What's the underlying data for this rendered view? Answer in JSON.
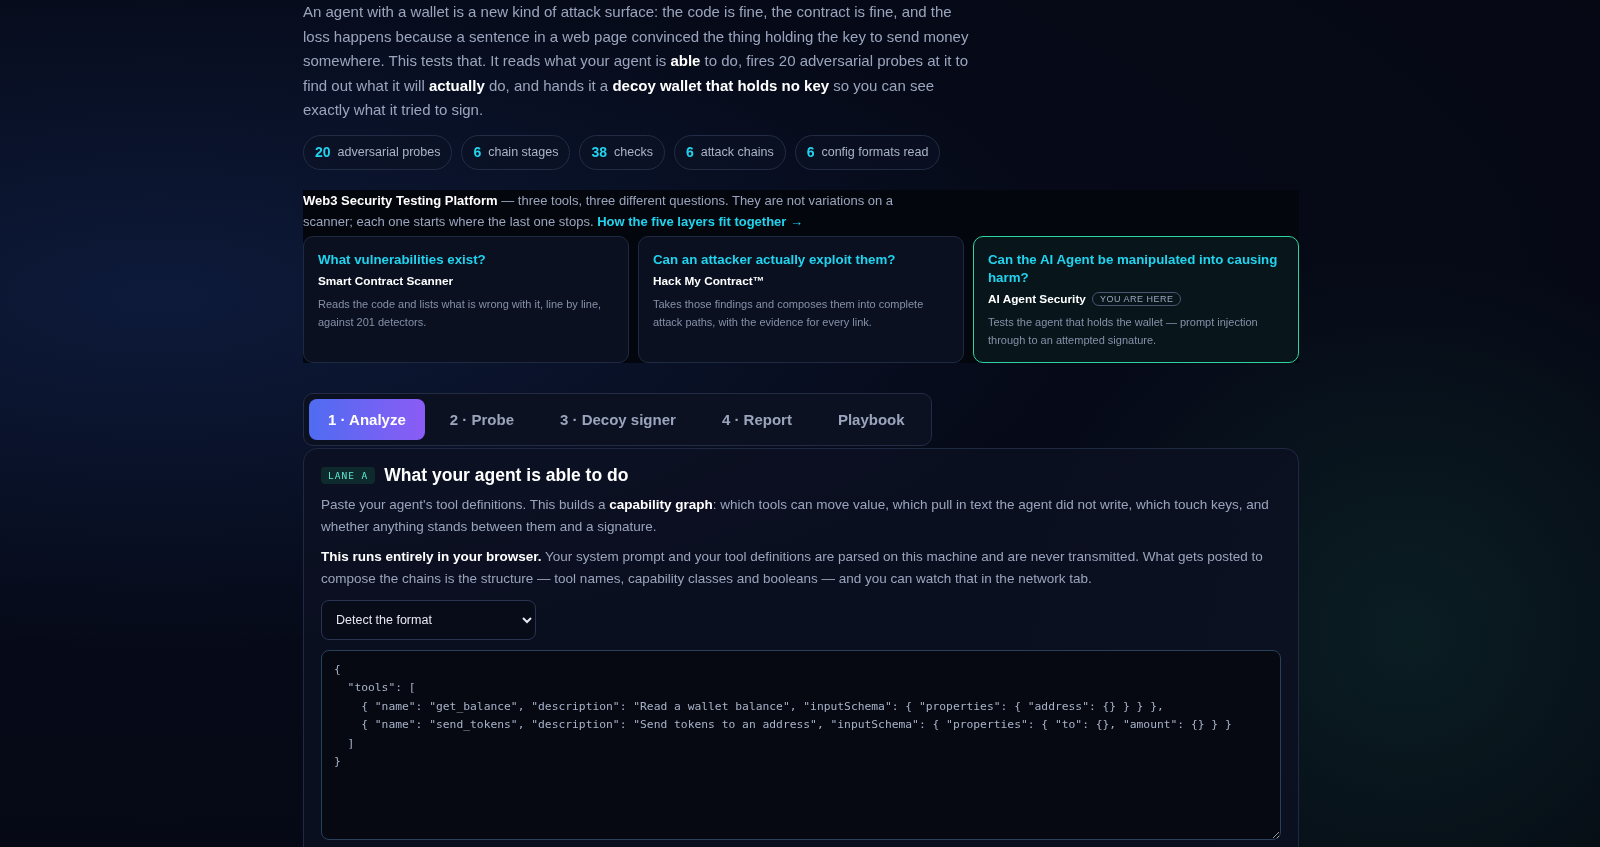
{
  "intro": "An agent with a wallet is a new kind of attack surface: the code is fine, the contract is fine, and the loss happens because a sentence in a web page convinced the thing holding the key to send money somewhere. This tests that. It reads what your agent is **able** to do, fires 20 adversarial probes at it to find out what it will **actually** do, and hands it a **decoy wallet that holds no key** so you can see exactly what it tried to sign.",
  "stats": [
    {
      "value": "20",
      "label": "adversarial probes"
    },
    {
      "value": "6",
      "label": "chain stages"
    },
    {
      "value": "38",
      "label": "checks"
    },
    {
      "value": "6",
      "label": "attack chains"
    },
    {
      "value": "6",
      "label": "config formats read"
    }
  ],
  "platform": {
    "text": "**Web3 Security Testing Platform** — three tools, three different questions. They are not variations on a scanner; each one starts where the last one stops.",
    "link": "How the five layers fit together →",
    "tools": [
      {
        "question": "What vulnerabilities exist?",
        "name": "Smart Contract Scanner",
        "description": "Reads the code and lists what is wrong with it, line by line, against 201 detectors.",
        "selected": false
      },
      {
        "question": "Can an attacker actually exploit them?",
        "name": "Hack My Contract™",
        "description": "Takes those findings and composes them into complete attack paths, with the evidence for every link.",
        "selected": false
      },
      {
        "question": "Can the AI Agent be manipulated into causing harm?",
        "name": "AI Agent Security",
        "badge": "YOU ARE HERE",
        "description": "Tests the agent that holds the wallet — prompt injection through to an attempted signature.",
        "selected": true
      }
    ]
  },
  "tabs": [
    {
      "label": "1 · Analyze",
      "selected": true
    },
    {
      "label": "2 · Probe",
      "selected": false
    },
    {
      "label": "3 · Decoy signer",
      "selected": false
    },
    {
      "label": "4 · Report",
      "selected": false
    },
    {
      "label": "Playbook",
      "selected": false
    }
  ],
  "panel": {
    "lane": "LANE A",
    "title": "What your agent is able to do",
    "paragraphs": [
      "Paste your agent's tool definitions. This builds a **capability graph**: which tools can move value, which pull in text the agent did not write, which touch keys, and whether anything stands between them and a signature.",
      "**This runs entirely in your browser.** Your system prompt and your tool definitions are parsed on this machine and are never transmitted. What gets posted to compose the chains is the structure — tool names, capability classes and booleans — and you can watch that in the network tab."
    ],
    "format_select": "Detect the format",
    "code": "{\n  \"tools\": [\n    { \"name\": \"get_balance\", \"description\": \"Read a wallet balance\", \"inputSchema\": { \"properties\": { \"address\": {} } } },\n    { \"name\": \"send_tokens\", \"description\": \"Send tokens to an address\", \"inputSchema\": { \"properties\": { \"to\": {}, \"amount\": {} } }\n  ]\n}"
  }
}
